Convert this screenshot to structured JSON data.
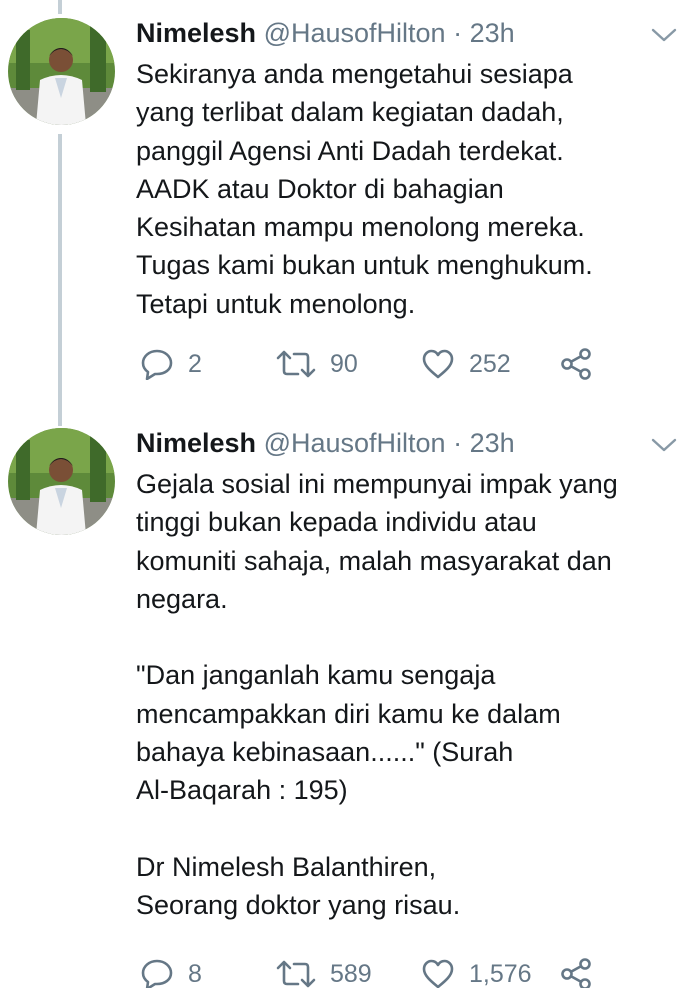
{
  "tweets": [
    {
      "author": {
        "name": "Nimelesh",
        "handle": "@HausofHilton",
        "separator": "·",
        "time": "23h"
      },
      "text": "Sekiranya anda mengetahui sesiapa\nyang terlibat dalam kegiatan dadah,\npanggil Agensi Anti Dadah terdekat.\n AADK atau Doktor di bahagian\nKesihatan mampu menolong mereka.\nTugas kami bukan untuk menghukum.\nTetapi untuk menolong.",
      "stats": {
        "replies": "2",
        "retweets": "90",
        "likes": "252"
      }
    },
    {
      "author": {
        "name": "Nimelesh",
        "handle": "@HausofHilton",
        "separator": "·",
        "time": "23h"
      },
      "text": "Gejala sosial ini mempunyai impak yang\ntinggi bukan kepada individu atau\nkomuniti sahaja, malah masyarakat dan\nnegara.\n\n\"Dan janganlah kamu sengaja\nmencampakkan diri kamu ke dalam\nbahaya kebinasaan......\" (Surah\nAl-Baqarah : 195)\n\nDr Nimelesh Balanthiren,\nSeorang doktor yang risau.",
      "stats": {
        "replies": "8",
        "retweets": "589",
        "likes": "1,576"
      }
    }
  ],
  "icons": {
    "reply": "reply-icon",
    "retweet": "retweet-icon",
    "like": "heart-icon",
    "share": "share-icon",
    "caret": "chevron-down-icon"
  },
  "colors": {
    "text": "#14171a",
    "secondary": "#657786",
    "thread_line": "#c4cfd6"
  }
}
